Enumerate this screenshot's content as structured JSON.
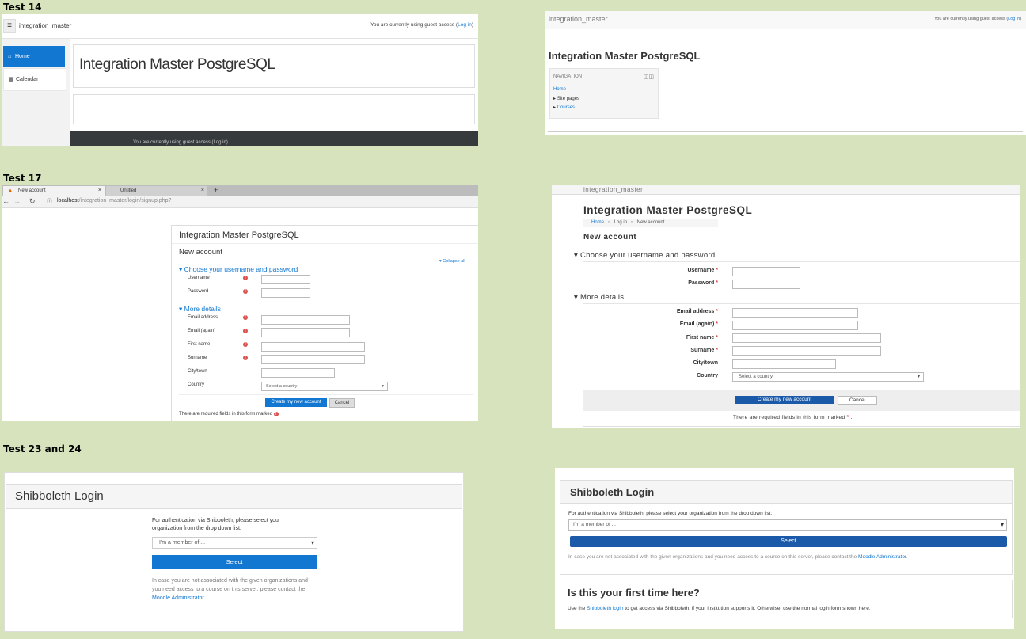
{
  "sections": {
    "s1": "Test 14",
    "s2": "Test 17",
    "s3": "Test 23 and 24"
  },
  "t14a": {
    "menu_glyph": "≡",
    "site_name": "integration_master",
    "guest_text": "You are currently using guest access (",
    "login_link": "Log in",
    "guest_close": ")",
    "nav_home": "Home",
    "nav_calendar": "Calendar",
    "heading": "Integration Master PostgreSQL",
    "footer_text": "You are currently using guest access (Log in)"
  },
  "t14b": {
    "site_name": "integration_master",
    "guest_text": "You are currently using guest access (",
    "login_link": "Log in",
    "guest_close": ")",
    "heading": "Integration Master PostgreSQL",
    "block_title": "NAVIGATION",
    "home": "Home",
    "site_pages": "Site pages",
    "courses": "Courses"
  },
  "t17a": {
    "tab1": "New account",
    "tab2": "Untitled",
    "tab_close": "×",
    "new_tab": "+",
    "url_host": "localhost",
    "url_path": "/integration_master/login/signup.php?",
    "site_heading": "Integration Master PostgreSQL",
    "page_heading": "New account",
    "collapse_all": "Collapse all",
    "section1": "Choose your username and password",
    "section2": "More details",
    "labels": [
      "Username",
      "Password",
      "Email address",
      "Email (again)",
      "First name",
      "Surname",
      "City/town",
      "Country"
    ],
    "country_placeholder": "Select a country",
    "create_btn": "Create my new account",
    "cancel_btn": "Cancel",
    "required_note": "There are required fields in this form marked",
    "required_mark": "!"
  },
  "t17b": {
    "site_name": "integration_master",
    "heading": "Integration Master PostgreSQL",
    "crumb_home": "Home",
    "crumb_login": "Log in",
    "crumb_new": "New account",
    "crumb_sep": "»",
    "page_heading": "New account",
    "section1": "Choose your username and password",
    "section2": "More details",
    "labels": [
      "Username",
      "Password",
      "Email address",
      "Email (again)",
      "First name",
      "Surname",
      "City/town",
      "Country"
    ],
    "required_star": "*",
    "country_placeholder": "Select a country",
    "create_btn": "Create my new account",
    "cancel_btn": "Cancel",
    "required_note": "There are required fields in this form marked",
    "required_mark": "*",
    "note_end": "."
  },
  "t23a": {
    "title": "Shibboleth Login",
    "instruction": "For authentication via Shibboleth, please select your organization from the drop down list:",
    "select_value": "I'm a member of ...",
    "select_btn": "Select",
    "note": "In case you are not associated with the given organizations and you need access to a course on this server, please contact the",
    "admin_link": "Moodle Administrator",
    "note_end": "."
  },
  "t23b": {
    "title": "Shibboleth Login",
    "instruction": "For authentication via Shibboleth, please select your organization from the drop down list:",
    "select_value": "I'm a member of ...",
    "select_btn": "Select",
    "note": "In case you are not associated with the given organizations and you need access to a course on this server, please contact the",
    "admin_link": "Moodle Administrator",
    "note_end": ".",
    "first_time": "Is this your first time here?",
    "use_text": "Use the",
    "shib_link": "Shibboleth login",
    "rest_text": "to get access via Shibboleth, if your institution supports it. Otherwise, use the normal login form shown here."
  },
  "colors": {
    "background": "#d6e3bc",
    "primary": "#1177d1",
    "dark_footer": "#373a3c",
    "required": "#d9534f"
  }
}
